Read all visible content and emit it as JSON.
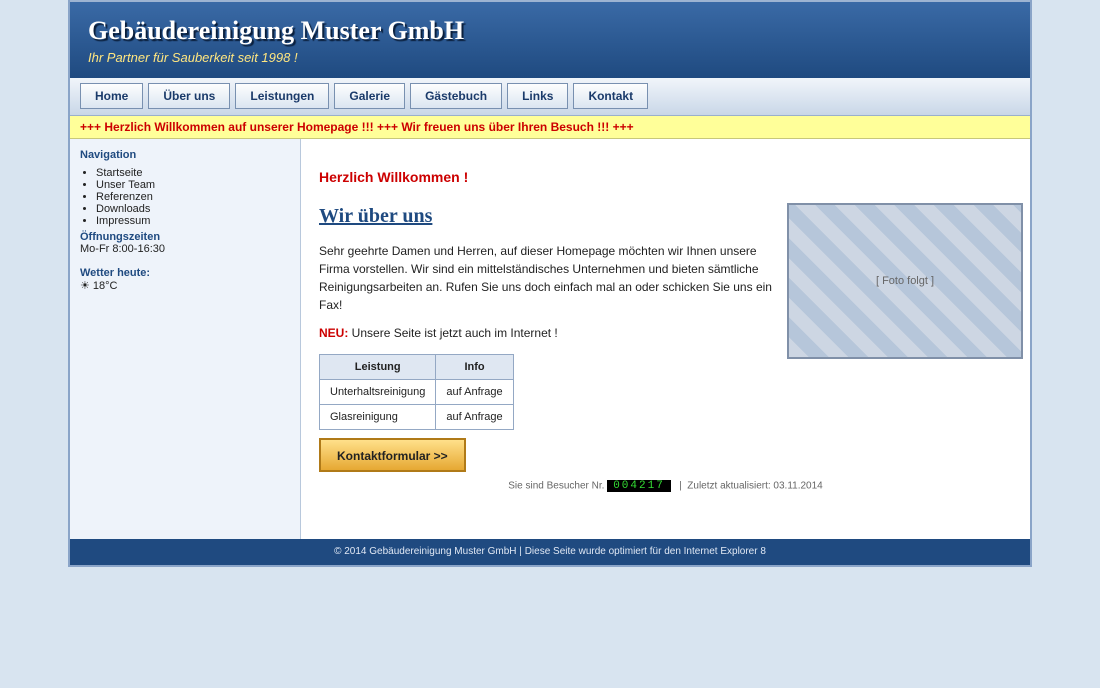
{
  "header": {
    "title": "Gebäudereinigung Muster GmbH",
    "slogan": "Ihr Partner für Sauberkeit seit 1998 !"
  },
  "nav": [
    "Home",
    "Über uns",
    "Leistungen",
    "Galerie",
    "Gästebuch",
    "Links",
    "Kontakt"
  ],
  "ticker": "+++ Herzlich Willkommen auf unserer Homepage !!! +++ Wir freuen uns über Ihren Besuch !!! +++",
  "sidebar": {
    "nav_head": "Navigation",
    "items": [
      "Startseite",
      "Unser Team",
      "Referenzen",
      "Downloads",
      "Impressum"
    ],
    "hours_head": "Öffnungszeiten",
    "hours": "Mo-Fr 8:00-16:30",
    "weather_head": "Wetter heute:",
    "weather": "☀ 18°C"
  },
  "content": {
    "welcome": "Herzlich Willkommen !",
    "about_title": "Wir über uns",
    "intro": "Sehr geehrte Damen und Herren, auf dieser Homepage möchten wir Ihnen unsere Firma vorstellen. Wir sind ein mittelständisches Unternehmen und bieten sämtliche Reinigungsarbeiten an. Rufen Sie uns doch einfach mal an oder schicken Sie uns ein Fax!",
    "neu_tag": "NEU:",
    "neu_text": " Unsere Seite ist jetzt auch im Internet !",
    "photo_label": "[ Foto folgt ]",
    "table": {
      "headers": [
        "Leistung",
        "Info"
      ],
      "rows": [
        [
          "Unterhaltsreinigung",
          "auf Anfrage"
        ],
        [
          "Glasreinigung",
          "auf Anfrage"
        ]
      ]
    },
    "contact_button": "Kontaktformular >>",
    "counter_prefix": "Sie sind Besucher Nr.",
    "counter_value": "004217",
    "counter_suffix": "  |  Zuletzt aktualisiert: 03.11.2014"
  },
  "footer": "© 2014 Gebäudereinigung Muster GmbH | Diese Seite wurde optimiert für den Internet Explorer 8"
}
